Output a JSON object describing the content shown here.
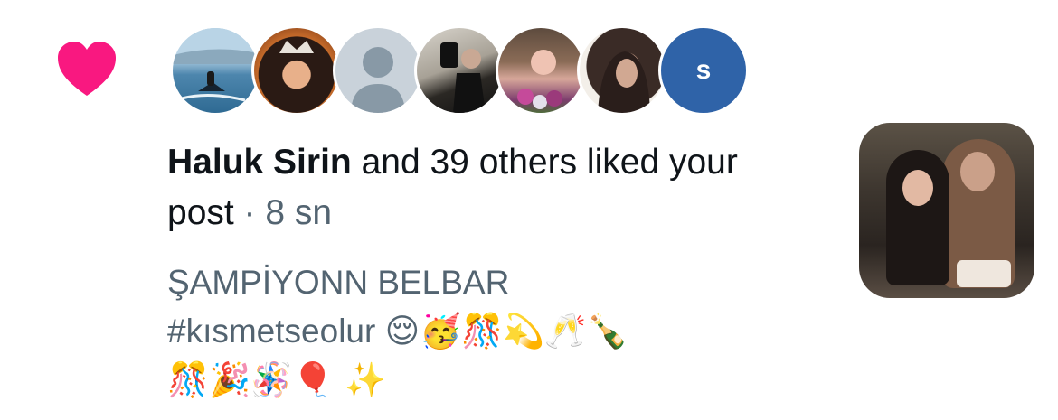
{
  "notification": {
    "icon": "heart-icon",
    "accent_color": "#f91880",
    "avatars": [
      {
        "name": "avatar-1",
        "type": "photo"
      },
      {
        "name": "avatar-2",
        "type": "photo"
      },
      {
        "name": "avatar-3",
        "type": "default"
      },
      {
        "name": "avatar-4",
        "type": "photo"
      },
      {
        "name": "avatar-5",
        "type": "photo"
      },
      {
        "name": "avatar-6",
        "type": "photo"
      },
      {
        "name": "avatar-7",
        "type": "initial",
        "letter": "s",
        "color": "#2f63a8"
      }
    ],
    "actor_name": "Haluk Sirin",
    "action_text": " and 39 others liked your post",
    "separator": " · ",
    "timestamp": "8 sn",
    "post_line1": "ŞAMPİYONN BELBAR",
    "post_hashtag": "#kısmetseolur",
    "post_emojis_line1": "😌🥳🎊💫🥂🍾",
    "post_emojis_line2": "🎊🎉🪅🎈 ✨"
  }
}
